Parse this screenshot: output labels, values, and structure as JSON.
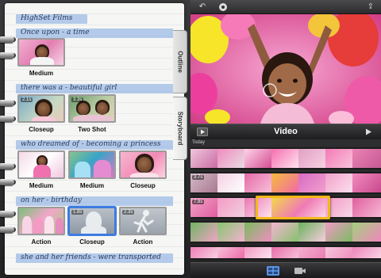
{
  "notebook": {
    "project_title": "HighSet Films",
    "sections": [
      {
        "title": "Once upon - a time",
        "shots": [
          {
            "label": "Medium",
            "duration": ""
          }
        ]
      },
      {
        "title": "there was a - beautiful girl",
        "shots": [
          {
            "label": "Closeup",
            "duration": "2.1s"
          },
          {
            "label": "Two Shot",
            "duration": "3.3s"
          }
        ]
      },
      {
        "title": "who dreamed of - becoming a princess",
        "shots": [
          {
            "label": "Medium",
            "duration": ""
          },
          {
            "label": "Medium",
            "duration": ""
          },
          {
            "label": "Closeup",
            "duration": ""
          }
        ]
      },
      {
        "title": "on her - birthday",
        "shots": [
          {
            "label": "Action",
            "duration": ""
          },
          {
            "label": "Closeup",
            "duration": "1.8s"
          },
          {
            "label": "Action",
            "duration": "2.3s"
          }
        ]
      },
      {
        "title": "she and her friends - were transported",
        "shots": []
      }
    ],
    "tabs": [
      {
        "label": "Outline"
      },
      {
        "label": "Storyboard",
        "active": true
      }
    ]
  },
  "viewer": {
    "panel_title": "Video"
  },
  "browser": {
    "section_label": "Today",
    "rows": [
      {
        "durations": [
          "",
          "",
          "",
          "",
          "",
          "",
          ""
        ]
      },
      {
        "durations": [
          "3.7s",
          "",
          "",
          "",
          "",
          "",
          ""
        ]
      },
      {
        "durations": [
          "7.8s",
          "",
          "",
          "",
          "",
          "",
          ""
        ],
        "selected_index": 3
      },
      {
        "durations": [
          "",
          "",
          "",
          "",
          "",
          "",
          ""
        ]
      },
      {
        "durations": [
          "",
          "",
          "",
          "",
          "",
          "",
          ""
        ]
      }
    ]
  },
  "icons": {
    "top_left": "undo-icon",
    "top_gear": "settings-icon",
    "top_right": "share-icon",
    "play": "play-icon",
    "skip": "next-icon",
    "bottom_left": "film-grid-icon",
    "bottom_right": "camera-icon"
  },
  "colors": {
    "accent": "#3d7be0",
    "selection": "#f3b817",
    "strip": "#7da5e1",
    "dark": "#1c1c1c"
  }
}
